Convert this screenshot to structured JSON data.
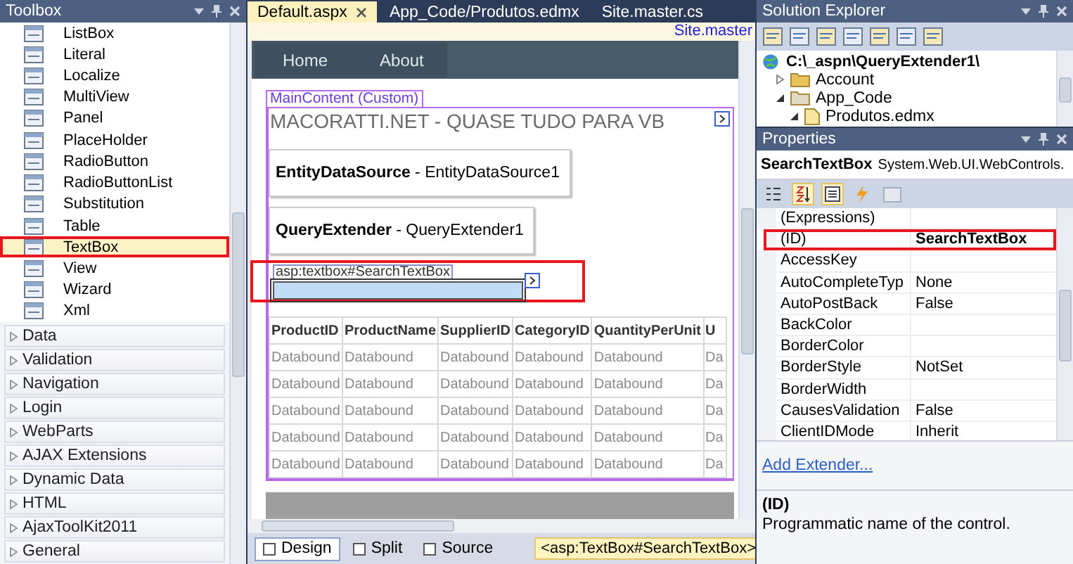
{
  "toolbox": {
    "title": "Toolbox",
    "items": [
      {
        "label": "ListBox",
        "selected": false,
        "highlighted": false
      },
      {
        "label": "Literal",
        "selected": false,
        "highlighted": false
      },
      {
        "label": "Localize",
        "selected": false,
        "highlighted": false
      },
      {
        "label": "MultiView",
        "selected": false,
        "highlighted": false
      },
      {
        "label": "Panel",
        "selected": false,
        "highlighted": false
      },
      {
        "label": "PlaceHolder",
        "selected": false,
        "highlighted": false
      },
      {
        "label": "RadioButton",
        "selected": false,
        "highlighted": false
      },
      {
        "label": "RadioButtonList",
        "selected": false,
        "highlighted": false
      },
      {
        "label": "Substitution",
        "selected": false,
        "highlighted": false
      },
      {
        "label": "Table",
        "selected": false,
        "highlighted": false
      },
      {
        "label": "TextBox",
        "selected": true,
        "highlighted": true
      },
      {
        "label": "View",
        "selected": false,
        "highlighted": false
      },
      {
        "label": "Wizard",
        "selected": false,
        "highlighted": false
      },
      {
        "label": "Xml",
        "selected": false,
        "highlighted": false
      }
    ],
    "categories": [
      {
        "label": "Data",
        "expanded": false
      },
      {
        "label": "Validation",
        "expanded": false
      },
      {
        "label": "Navigation",
        "expanded": false
      },
      {
        "label": "Login",
        "expanded": false
      },
      {
        "label": "WebParts",
        "expanded": false
      },
      {
        "label": "AJAX Extensions",
        "expanded": false
      },
      {
        "label": "Dynamic Data",
        "expanded": false
      },
      {
        "label": "HTML",
        "expanded": false
      },
      {
        "label": "AjaxToolKit2011",
        "expanded": false
      },
      {
        "label": "General",
        "expanded": false
      }
    ]
  },
  "editor": {
    "tabs": [
      {
        "label": "Default.aspx",
        "selected": true
      },
      {
        "label": "App_Code/Produtos.edmx",
        "selected": false
      },
      {
        "label": "Site.master.cs",
        "selected": false
      }
    ],
    "master_link": "Site.master",
    "nav": [
      "Home",
      "About"
    ],
    "content_label": "MainContent (Custom)",
    "heading": "MACORATTI.NET - QUASE TUDO PARA VB",
    "controls": [
      "**EntityDataSource** - EntityDataSource1",
      "**QueryExtender** - QueryExtender1"
    ],
    "textbox": {
      "tag": "asp:textbox#SearchTextBox",
      "highlighted": true
    },
    "table": {
      "columns": [
        "ProductID",
        "ProductName",
        "SupplierID",
        "CategoryID",
        "QuantityPerUnit",
        "U"
      ],
      "rows": [
        [
          "Databound",
          "Databound",
          "Databound",
          "Databound",
          "Databound",
          "Da"
        ],
        [
          "Databound",
          "Databound",
          "Databound",
          "Databound",
          "Databound",
          "Da"
        ],
        [
          "Databound",
          "Databound",
          "Databound",
          "Databound",
          "Databound",
          "Da"
        ],
        [
          "Databound",
          "Databound",
          "Databound",
          "Databound",
          "Databound",
          "Da"
        ],
        [
          "Databound",
          "Databound",
          "Databound",
          "Databound",
          "Databound",
          "Da"
        ]
      ]
    },
    "views": [
      {
        "label": "Design",
        "selected": true
      },
      {
        "label": "Split",
        "selected": false
      },
      {
        "label": "Source",
        "selected": false
      }
    ],
    "breadcrumb": "<asp:TextBox#SearchTextBox>"
  },
  "solution_explorer": {
    "title": "Solution Explorer",
    "tree": [
      {
        "label": "C:\\_aspn\\QueryExtender1\\",
        "kind": "project",
        "children": [
          {
            "label": "Account",
            "kind": "folder",
            "expanded": false
          },
          {
            "label": "App_Code",
            "kind": "folder",
            "expanded": true,
            "children": [
              {
                "label": "Produtos.edmx",
                "kind": "file",
                "expanded": true
              }
            ]
          }
        ]
      }
    ]
  },
  "properties": {
    "title": "Properties",
    "object_name": "SearchTextBox",
    "object_type": "System.Web.UI.WebControls.",
    "rows": [
      {
        "name": "(Expressions)",
        "highlighted": false
      },
      {
        "name": "(ID)",
        "value": "SearchTextBox",
        "modified": true,
        "highlighted": true
      },
      {
        "name": "AccessKey",
        "highlighted": false
      },
      {
        "name": "AutoCompleteTyp",
        "value": "None",
        "modified": false,
        "highlighted": false
      },
      {
        "name": "AutoPostBack",
        "value": "False",
        "modified": false,
        "highlighted": false
      },
      {
        "name": "BackColor",
        "highlighted": false
      },
      {
        "name": "BorderColor",
        "highlighted": false
      },
      {
        "name": "BorderStyle",
        "value": "NotSet",
        "modified": false,
        "highlighted": false
      },
      {
        "name": "BorderWidth",
        "highlighted": false
      },
      {
        "name": "CausesValidation",
        "value": "False",
        "modified": false,
        "highlighted": false
      },
      {
        "name": "ClientIDMode",
        "value": "Inherit",
        "modified": false,
        "highlighted": false
      }
    ],
    "link": "Add Extender...",
    "description_title": "(ID)",
    "description": "Programmatic name of the control."
  }
}
